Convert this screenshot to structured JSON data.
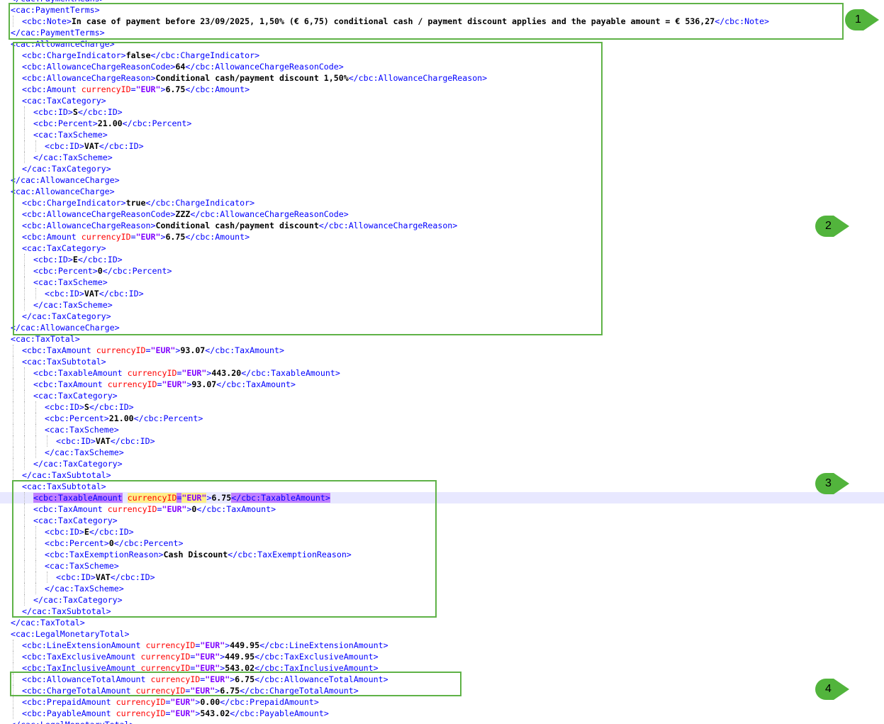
{
  "lines": [
    {
      "indent": 0,
      "tokens": [
        [
          "tg",
          "</cac:PaymentMeans>"
        ]
      ]
    },
    {
      "indent": 0,
      "tokens": [
        [
          "tg",
          "<cac:PaymentTerms>"
        ]
      ]
    },
    {
      "indent": 1,
      "tokens": [
        [
          "tg",
          "<cbc:Note>"
        ],
        [
          "tx",
          "In case of payment before 23/09/2025, 1,50% (€ 6,75) conditional cash / payment discount applies and the payable amount = € 536,27"
        ],
        [
          "tg",
          "</cbc:Note>"
        ]
      ]
    },
    {
      "indent": 0,
      "tokens": [
        [
          "tg",
          "</cac:PaymentTerms>"
        ]
      ]
    },
    {
      "indent": 0,
      "tokens": [
        [
          "tg",
          "<cac:AllowanceCharge>"
        ]
      ]
    },
    {
      "indent": 1,
      "tokens": [
        [
          "tg",
          "<cbc:ChargeIndicator>"
        ],
        [
          "tx",
          "false"
        ],
        [
          "tg",
          "</cbc:ChargeIndicator>"
        ]
      ]
    },
    {
      "indent": 1,
      "tokens": [
        [
          "tg",
          "<cbc:AllowanceChargeReasonCode>"
        ],
        [
          "tx",
          "64"
        ],
        [
          "tg",
          "</cbc:AllowanceChargeReasonCode>"
        ]
      ]
    },
    {
      "indent": 1,
      "tokens": [
        [
          "tg",
          "<cbc:AllowanceChargeReason>"
        ],
        [
          "tx",
          "Conditional cash/payment discount 1,50%"
        ],
        [
          "tg",
          "</cbc:AllowanceChargeReason>"
        ]
      ]
    },
    {
      "indent": 1,
      "tokens": [
        [
          "tg",
          "<cbc:Amount "
        ],
        [
          "at",
          "currencyID"
        ],
        [
          "tg",
          "="
        ],
        [
          "av",
          "\"EUR\""
        ],
        [
          "tg",
          ">"
        ],
        [
          "tx",
          "6.75"
        ],
        [
          "tg",
          "</cbc:Amount>"
        ]
      ]
    },
    {
      "indent": 1,
      "tokens": [
        [
          "tg",
          "<cac:TaxCategory>"
        ]
      ]
    },
    {
      "indent": 2,
      "tokens": [
        [
          "tg",
          "<cbc:ID>"
        ],
        [
          "tx",
          "S"
        ],
        [
          "tg",
          "</cbc:ID>"
        ]
      ]
    },
    {
      "indent": 2,
      "tokens": [
        [
          "tg",
          "<cbc:Percent>"
        ],
        [
          "tx",
          "21.00"
        ],
        [
          "tg",
          "</cbc:Percent>"
        ]
      ]
    },
    {
      "indent": 2,
      "tokens": [
        [
          "tg",
          "<cac:TaxScheme>"
        ]
      ]
    },
    {
      "indent": 3,
      "tokens": [
        [
          "tg",
          "<cbc:ID>"
        ],
        [
          "tx",
          "VAT"
        ],
        [
          "tg",
          "</cbc:ID>"
        ]
      ]
    },
    {
      "indent": 2,
      "tokens": [
        [
          "tg",
          "</cac:TaxScheme>"
        ]
      ]
    },
    {
      "indent": 1,
      "tokens": [
        [
          "tg",
          "</cac:TaxCategory>"
        ]
      ]
    },
    {
      "indent": 0,
      "tokens": [
        [
          "tg",
          "</cac:AllowanceCharge>"
        ]
      ]
    },
    {
      "indent": 0,
      "tokens": [
        [
          "tg",
          "<cac:AllowanceCharge>"
        ]
      ]
    },
    {
      "indent": 1,
      "tokens": [
        [
          "tg",
          "<cbc:ChargeIndicator>"
        ],
        [
          "tx",
          "true"
        ],
        [
          "tg",
          "</cbc:ChargeIndicator>"
        ]
      ]
    },
    {
      "indent": 1,
      "tokens": [
        [
          "tg",
          "<cbc:AllowanceChargeReasonCode>"
        ],
        [
          "tx",
          "ZZZ"
        ],
        [
          "tg",
          "</cbc:AllowanceChargeReasonCode>"
        ]
      ]
    },
    {
      "indent": 1,
      "tokens": [
        [
          "tg",
          "<cbc:AllowanceChargeReason>"
        ],
        [
          "tx",
          "Conditional cash/payment discount"
        ],
        [
          "tg",
          "</cbc:AllowanceChargeReason>"
        ]
      ]
    },
    {
      "indent": 1,
      "tokens": [
        [
          "tg",
          "<cbc:Amount "
        ],
        [
          "at",
          "currencyID"
        ],
        [
          "tg",
          "="
        ],
        [
          "av",
          "\"EUR\""
        ],
        [
          "tg",
          ">"
        ],
        [
          "tx",
          "6.75"
        ],
        [
          "tg",
          "</cbc:Amount>"
        ]
      ]
    },
    {
      "indent": 1,
      "tokens": [
        [
          "tg",
          "<cac:TaxCategory>"
        ]
      ]
    },
    {
      "indent": 2,
      "tokens": [
        [
          "tg",
          "<cbc:ID>"
        ],
        [
          "tx",
          "E"
        ],
        [
          "tg",
          "</cbc:ID>"
        ]
      ]
    },
    {
      "indent": 2,
      "tokens": [
        [
          "tg",
          "<cbc:Percent>"
        ],
        [
          "tx",
          "0"
        ],
        [
          "tg",
          "</cbc:Percent>"
        ]
      ]
    },
    {
      "indent": 2,
      "tokens": [
        [
          "tg",
          "<cac:TaxScheme>"
        ]
      ]
    },
    {
      "indent": 3,
      "tokens": [
        [
          "tg",
          "<cbc:ID>"
        ],
        [
          "tx",
          "VAT"
        ],
        [
          "tg",
          "</cbc:ID>"
        ]
      ]
    },
    {
      "indent": 2,
      "tokens": [
        [
          "tg",
          "</cac:TaxScheme>"
        ]
      ]
    },
    {
      "indent": 1,
      "tokens": [
        [
          "tg",
          "</cac:TaxCategory>"
        ]
      ]
    },
    {
      "indent": 0,
      "tokens": [
        [
          "tg",
          "</cac:AllowanceCharge>"
        ]
      ]
    },
    {
      "indent": 0,
      "tokens": [
        [
          "tg",
          "<cac:TaxTotal>"
        ]
      ]
    },
    {
      "indent": 1,
      "tokens": [
        [
          "tg",
          "<cbc:TaxAmount "
        ],
        [
          "at",
          "currencyID"
        ],
        [
          "tg",
          "="
        ],
        [
          "av",
          "\"EUR\""
        ],
        [
          "tg",
          ">"
        ],
        [
          "tx",
          "93.07"
        ],
        [
          "tg",
          "</cbc:TaxAmount>"
        ]
      ]
    },
    {
      "indent": 1,
      "tokens": [
        [
          "tg",
          "<cac:TaxSubtotal>"
        ]
      ]
    },
    {
      "indent": 2,
      "tokens": [
        [
          "tg",
          "<cbc:TaxableAmount "
        ],
        [
          "at",
          "currencyID"
        ],
        [
          "tg",
          "="
        ],
        [
          "av",
          "\"EUR\""
        ],
        [
          "tg",
          ">"
        ],
        [
          "tx",
          "443.20"
        ],
        [
          "tg",
          "</cbc:TaxableAmount>"
        ]
      ]
    },
    {
      "indent": 2,
      "tokens": [
        [
          "tg",
          "<cbc:TaxAmount "
        ],
        [
          "at",
          "currencyID"
        ],
        [
          "tg",
          "="
        ],
        [
          "av",
          "\"EUR\""
        ],
        [
          "tg",
          ">"
        ],
        [
          "tx",
          "93.07"
        ],
        [
          "tg",
          "</cbc:TaxAmount>"
        ]
      ]
    },
    {
      "indent": 2,
      "tokens": [
        [
          "tg",
          "<cac:TaxCategory>"
        ]
      ]
    },
    {
      "indent": 3,
      "tokens": [
        [
          "tg",
          "<cbc:ID>"
        ],
        [
          "tx",
          "S"
        ],
        [
          "tg",
          "</cbc:ID>"
        ]
      ]
    },
    {
      "indent": 3,
      "tokens": [
        [
          "tg",
          "<cbc:Percent>"
        ],
        [
          "tx",
          "21.00"
        ],
        [
          "tg",
          "</cbc:Percent>"
        ]
      ]
    },
    {
      "indent": 3,
      "tokens": [
        [
          "tg",
          "<cac:TaxScheme>"
        ]
      ]
    },
    {
      "indent": 4,
      "tokens": [
        [
          "tg",
          "<cbc:ID>"
        ],
        [
          "tx",
          "VAT"
        ],
        [
          "tg",
          "</cbc:ID>"
        ]
      ]
    },
    {
      "indent": 3,
      "tokens": [
        [
          "tg",
          "</cac:TaxScheme>"
        ]
      ]
    },
    {
      "indent": 2,
      "tokens": [
        [
          "tg",
          "</cac:TaxCategory>"
        ]
      ]
    },
    {
      "indent": 1,
      "tokens": [
        [
          "tg",
          "</cac:TaxSubtotal>"
        ]
      ]
    },
    {
      "indent": 1,
      "tokens": [
        [
          "tg",
          "<cac:TaxSubtotal>"
        ]
      ]
    },
    {
      "indent": 2,
      "current": true,
      "tokens": [
        [
          "tg",
          "<cbc:TaxableAmount",
          true
        ],
        [
          "tg",
          " "
        ],
        [
          "at",
          "currencyID",
          true
        ],
        [
          "tg",
          "=",
          true
        ],
        [
          "av",
          "\"EUR\"",
          true
        ],
        [
          "tg",
          ">"
        ],
        [
          "tx",
          "6.75"
        ],
        [
          "tg",
          "</cbc:TaxableAmount>",
          true
        ]
      ]
    },
    {
      "indent": 2,
      "tokens": [
        [
          "tg",
          "<cbc:TaxAmount "
        ],
        [
          "at",
          "currencyID"
        ],
        [
          "tg",
          "="
        ],
        [
          "av",
          "\"EUR\""
        ],
        [
          "tg",
          ">"
        ],
        [
          "tx",
          "0"
        ],
        [
          "tg",
          "</cbc:TaxAmount>"
        ]
      ]
    },
    {
      "indent": 2,
      "tokens": [
        [
          "tg",
          "<cac:TaxCategory>"
        ]
      ]
    },
    {
      "indent": 3,
      "tokens": [
        [
          "tg",
          "<cbc:ID>"
        ],
        [
          "tx",
          "E"
        ],
        [
          "tg",
          "</cbc:ID>"
        ]
      ]
    },
    {
      "indent": 3,
      "tokens": [
        [
          "tg",
          "<cbc:Percent>"
        ],
        [
          "tx",
          "0"
        ],
        [
          "tg",
          "</cbc:Percent>"
        ]
      ]
    },
    {
      "indent": 3,
      "tokens": [
        [
          "tg",
          "<cbc:TaxExemptionReason>"
        ],
        [
          "tx",
          "Cash Discount"
        ],
        [
          "tg",
          "</cbc:TaxExemptionReason>"
        ]
      ]
    },
    {
      "indent": 3,
      "tokens": [
        [
          "tg",
          "<cac:TaxScheme>"
        ]
      ]
    },
    {
      "indent": 4,
      "tokens": [
        [
          "tg",
          "<cbc:ID>"
        ],
        [
          "tx",
          "VAT"
        ],
        [
          "tg",
          "</cbc:ID>"
        ]
      ]
    },
    {
      "indent": 3,
      "tokens": [
        [
          "tg",
          "</cac:TaxScheme>"
        ]
      ]
    },
    {
      "indent": 2,
      "tokens": [
        [
          "tg",
          "</cac:TaxCategory>"
        ]
      ]
    },
    {
      "indent": 1,
      "tokens": [
        [
          "tg",
          "</cac:TaxSubtotal>"
        ]
      ]
    },
    {
      "indent": 0,
      "tokens": [
        [
          "tg",
          "</cac:TaxTotal>"
        ]
      ]
    },
    {
      "indent": 0,
      "tokens": [
        [
          "tg",
          "<cac:LegalMonetaryTotal>"
        ]
      ]
    },
    {
      "indent": 1,
      "tokens": [
        [
          "tg",
          "<cbc:LineExtensionAmount "
        ],
        [
          "at",
          "currencyID"
        ],
        [
          "tg",
          "="
        ],
        [
          "av",
          "\"EUR\""
        ],
        [
          "tg",
          ">"
        ],
        [
          "tx",
          "449.95"
        ],
        [
          "tg",
          "</cbc:LineExtensionAmount>"
        ]
      ]
    },
    {
      "indent": 1,
      "tokens": [
        [
          "tg",
          "<cbc:TaxExclusiveAmount "
        ],
        [
          "at",
          "currencyID"
        ],
        [
          "tg",
          "="
        ],
        [
          "av",
          "\"EUR\""
        ],
        [
          "tg",
          ">"
        ],
        [
          "tx",
          "449.95"
        ],
        [
          "tg",
          "</cbc:TaxExclusiveAmount>"
        ]
      ]
    },
    {
      "indent": 1,
      "tokens": [
        [
          "tg",
          "<cbc:TaxInclusiveAmount "
        ],
        [
          "at",
          "currencyID"
        ],
        [
          "tg",
          "="
        ],
        [
          "av",
          "\"EUR\""
        ],
        [
          "tg",
          ">"
        ],
        [
          "tx",
          "543.02"
        ],
        [
          "tg",
          "</cbc:TaxInclusiveAmount>"
        ]
      ]
    },
    {
      "indent": 1,
      "tokens": [
        [
          "tg",
          "<cbc:AllowanceTotalAmount "
        ],
        [
          "at",
          "currencyID"
        ],
        [
          "tg",
          "="
        ],
        [
          "av",
          "\"EUR\""
        ],
        [
          "tg",
          ">"
        ],
        [
          "tx",
          "6.75"
        ],
        [
          "tg",
          "</cbc:AllowanceTotalAmount>"
        ]
      ]
    },
    {
      "indent": 1,
      "tokens": [
        [
          "tg",
          "<cbc:ChargeTotalAmount "
        ],
        [
          "at",
          "currencyID"
        ],
        [
          "tg",
          "="
        ],
        [
          "av",
          "\"EUR\""
        ],
        [
          "tg",
          ">"
        ],
        [
          "tx",
          "6.75"
        ],
        [
          "tg",
          "</cbc:ChargeTotalAmount>"
        ]
      ]
    },
    {
      "indent": 1,
      "tokens": [
        [
          "tg",
          "<cbc:PrepaidAmount "
        ],
        [
          "at",
          "currencyID"
        ],
        [
          "tg",
          "="
        ],
        [
          "av",
          "\"EUR\""
        ],
        [
          "tg",
          ">"
        ],
        [
          "tx",
          "0.00"
        ],
        [
          "tg",
          "</cbc:PrepaidAmount>"
        ]
      ]
    },
    {
      "indent": 1,
      "tokens": [
        [
          "tg",
          "<cbc:PayableAmount "
        ],
        [
          "at",
          "currencyID"
        ],
        [
          "tg",
          "="
        ],
        [
          "av",
          "\"EUR\""
        ],
        [
          "tg",
          ">"
        ],
        [
          "tx",
          "543.02"
        ],
        [
          "tg",
          "</cbc:PayableAmount>"
        ]
      ]
    },
    {
      "indent": 0,
      "tokens": [
        [
          "tg",
          "</cac:LegalMonetaryTotal>"
        ]
      ]
    }
  ],
  "annotations": [
    {
      "label": "1"
    },
    {
      "label": "2"
    },
    {
      "label": "3"
    },
    {
      "label": "4"
    }
  ],
  "colors": {
    "tag": "#0000ff",
    "attribute": "#ff0000",
    "attribute_value": "#8000ff",
    "text": "#000000",
    "highlight_box": "#5fb247",
    "marker_fill": "#52b43c",
    "current_line": "#e8e8ff"
  }
}
